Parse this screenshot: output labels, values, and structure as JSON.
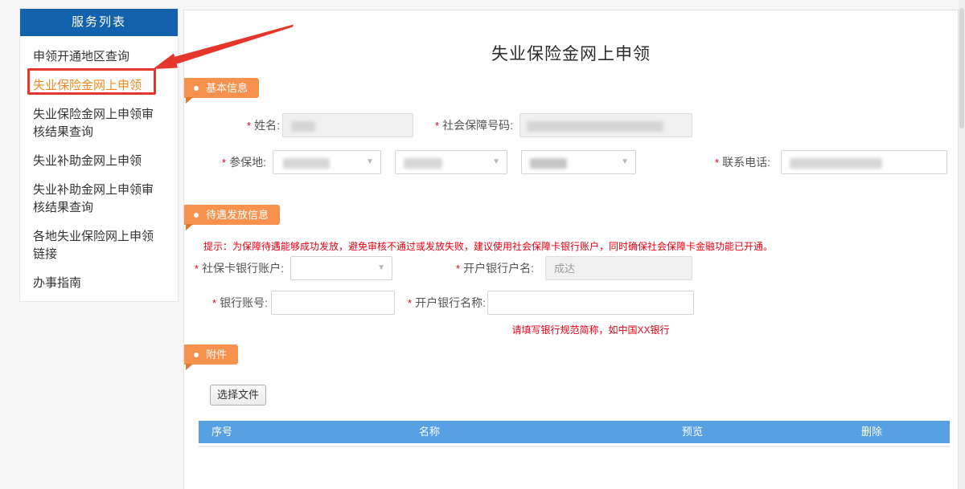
{
  "sidebar": {
    "header": "服务列表",
    "items": [
      {
        "label": "申领开通地区查询",
        "selected": false
      },
      {
        "label": "失业保险金网上申领",
        "selected": true
      },
      {
        "label": "失业保险金网上申领审核结果查询",
        "selected": false
      },
      {
        "label": "失业补助金网上申领",
        "selected": false
      },
      {
        "label": "失业补助金网上申领审核结果查询",
        "selected": false
      },
      {
        "label": "各地失业保险网上申领链接",
        "selected": false
      },
      {
        "label": "办事指南",
        "selected": false
      }
    ]
  },
  "main": {
    "title": "失业保险金网上申领",
    "sections": {
      "basic": {
        "title": "基本信息"
      },
      "payment": {
        "title": "待遇发放信息"
      },
      "attachment": {
        "title": "附件"
      }
    },
    "fields": {
      "name": {
        "required": "*",
        "label": "姓名:"
      },
      "ssn": {
        "required": "*",
        "label": "社会保障号码:"
      },
      "insured_place": {
        "required": "*",
        "label": "参保地:"
      },
      "phone": {
        "required": "*",
        "label": "联系电话:"
      },
      "sscard_account": {
        "required": "*",
        "label": "社保卡银行账户:"
      },
      "account_holder": {
        "required": "*",
        "label": "开户银行户名:",
        "value": "成达"
      },
      "bank_account": {
        "required": "*",
        "label": "银行账号:"
      },
      "bank_name": {
        "required": "*",
        "label": "开户银行名称:"
      }
    },
    "payment_hint": "提示：为保障待遇能够成功发放，避免审核不通过或发放失败，建议使用社会保障卡银行账户，同时确保社会保障卡金融功能已开通。",
    "bank_name_hint": "请填写银行规范简称，如中国XX银行",
    "attachment": {
      "file_button": "选择文件",
      "table_headers": [
        "序号",
        "名称",
        "预览",
        "删除"
      ]
    }
  },
  "colors": {
    "sidebar_header_blue": "#1362ad",
    "table_header_blue": "#57a0e3",
    "badge_orange": "#f6914e",
    "selected_item_orange": "#ee8a1f",
    "annotation_red": "#e6362b",
    "hint_red": "#e60012"
  }
}
